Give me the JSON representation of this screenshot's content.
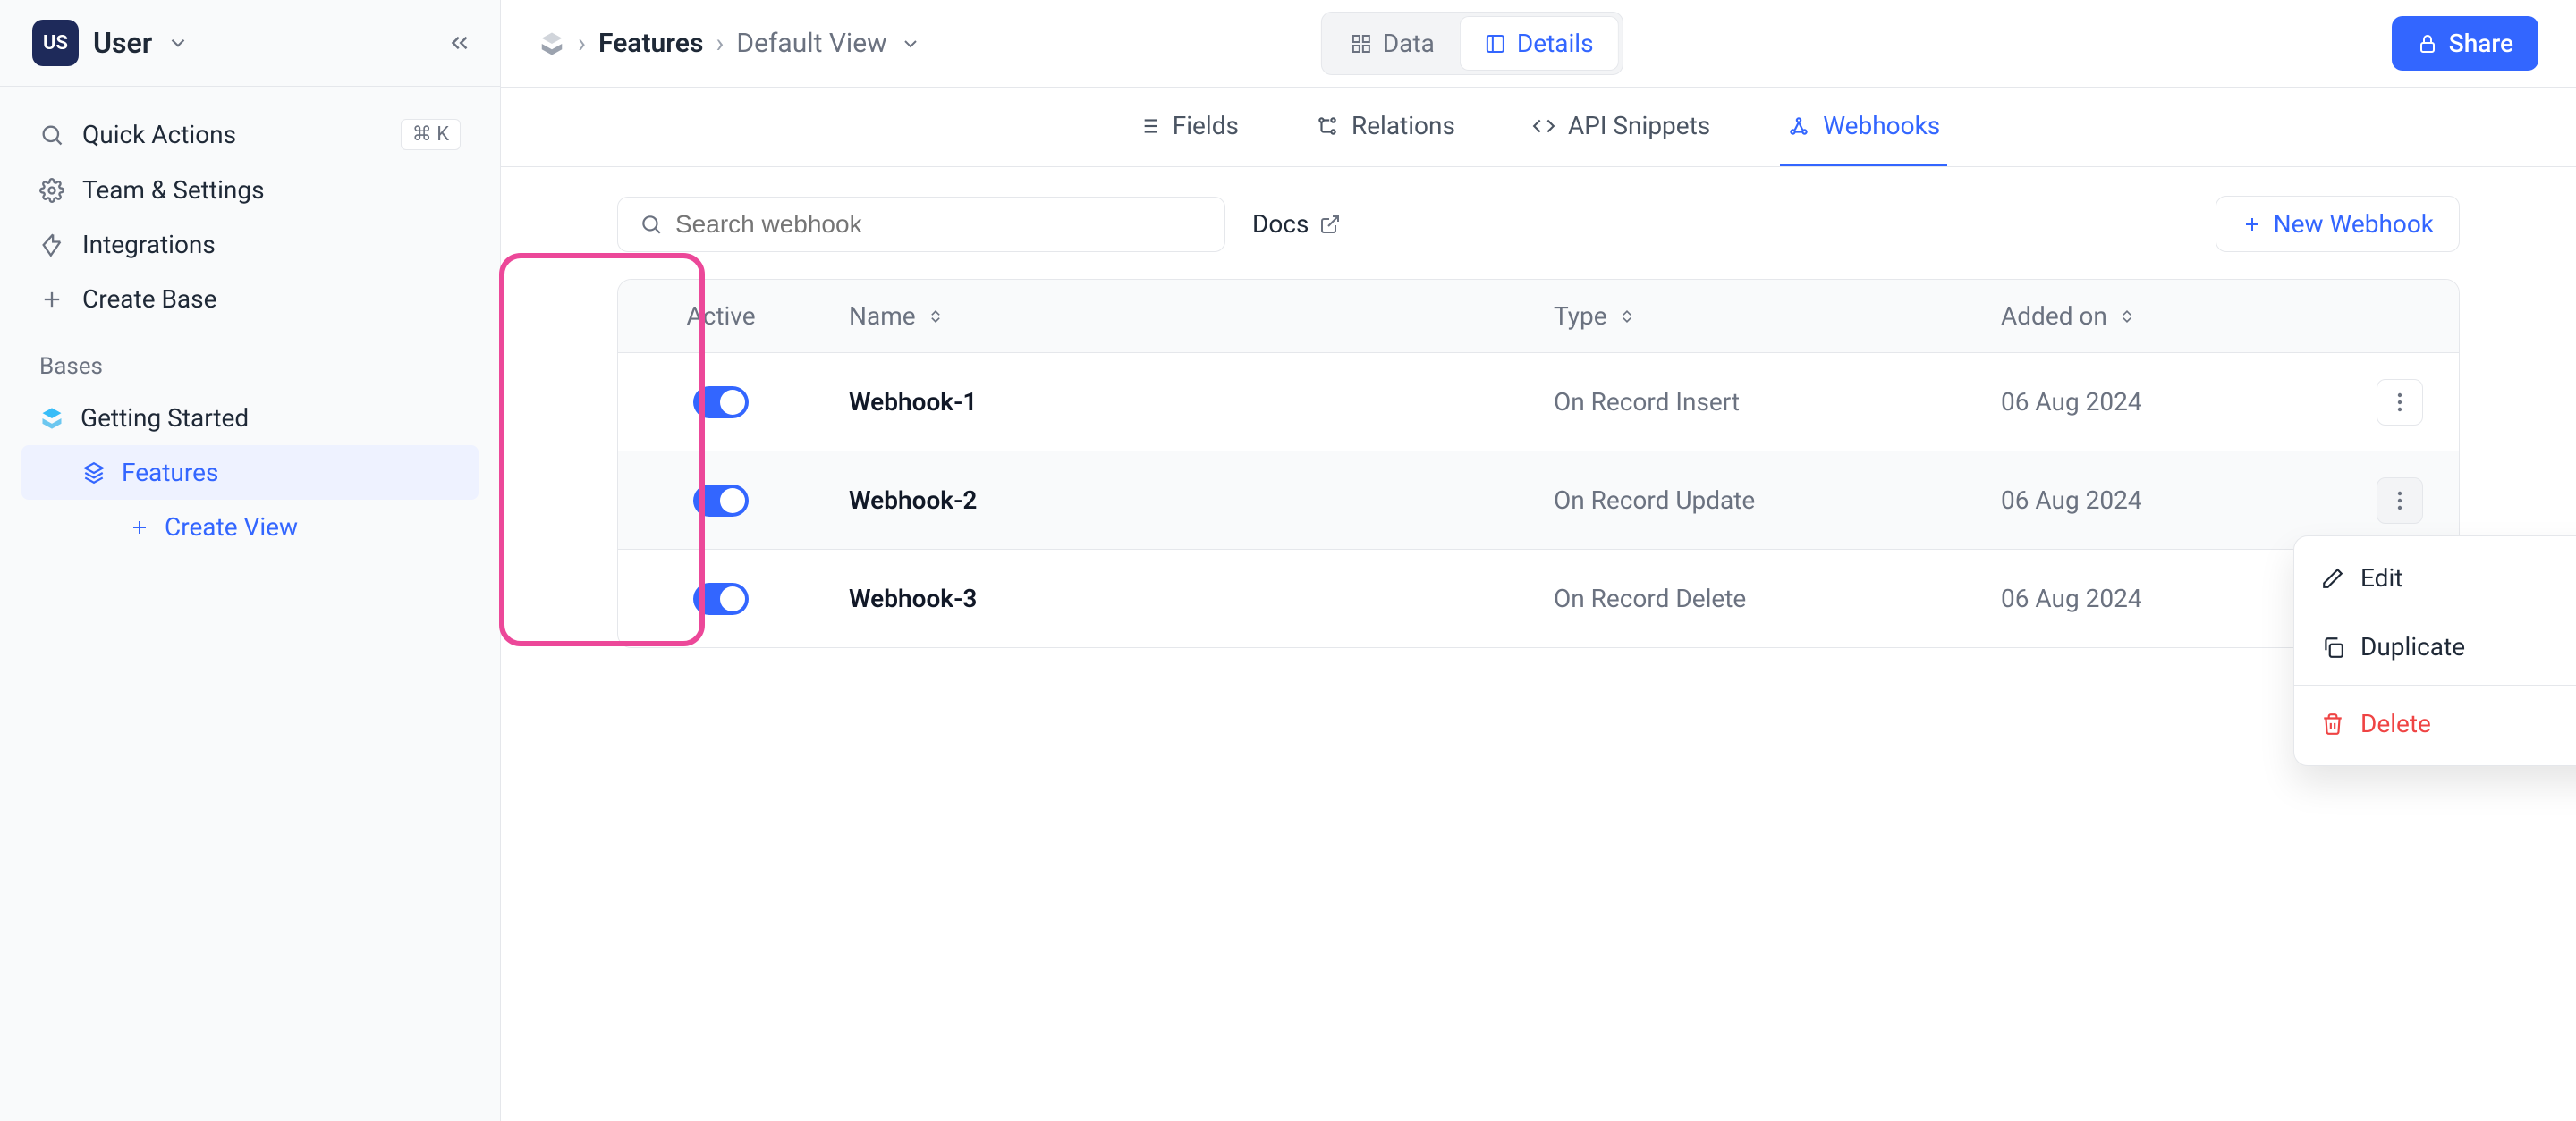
{
  "user": {
    "initials": "US",
    "name": "User"
  },
  "nav": {
    "quick_actions": "Quick Actions",
    "quick_actions_kbd": "⌘ K",
    "team_settings": "Team & Settings",
    "integrations": "Integrations",
    "create_base": "Create Base"
  },
  "bases": {
    "label": "Bases",
    "getting_started": "Getting Started",
    "features": "Features",
    "create_view": "Create View"
  },
  "breadcrumb": {
    "base": "Features",
    "view": "Default View"
  },
  "segment": {
    "data": "Data",
    "details": "Details"
  },
  "share": "Share",
  "tabs": {
    "fields": "Fields",
    "relations": "Relations",
    "api": "API Snippets",
    "webhooks": "Webhooks"
  },
  "webhooks_page": {
    "search_placeholder": "Search webhook",
    "docs": "Docs",
    "new": "New Webhook",
    "columns": {
      "active": "Active",
      "name": "Name",
      "type": "Type",
      "added_on": "Added on"
    },
    "rows": [
      {
        "active": true,
        "name": "Webhook-1",
        "type": "On Record Insert",
        "added_on": "06 Aug 2024"
      },
      {
        "active": true,
        "name": "Webhook-2",
        "type": "On Record Update",
        "added_on": "06 Aug 2024"
      },
      {
        "active": true,
        "name": "Webhook-3",
        "type": "On Record Delete",
        "added_on": "06 Aug 2024"
      }
    ]
  },
  "context_menu": {
    "edit": "Edit",
    "duplicate": "Duplicate",
    "delete": "Delete"
  }
}
